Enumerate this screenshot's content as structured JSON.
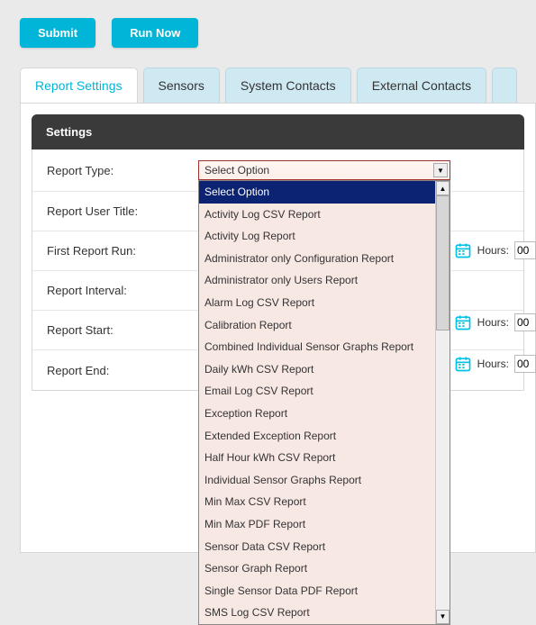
{
  "actions": {
    "submit": "Submit",
    "run_now": "Run Now"
  },
  "tabs": {
    "report_settings": "Report Settings",
    "sensors": "Sensors",
    "system_contacts": "System Contacts",
    "external_contacts": "External Contacts"
  },
  "panel": {
    "title": "Settings"
  },
  "form": {
    "report_type": {
      "label": "Report Type:",
      "selected": "Select Option"
    },
    "report_user_title": {
      "label": "Report User Title:"
    },
    "first_report_run": {
      "label": "First Report Run:",
      "hours_label": "Hours:",
      "hours_value": "00"
    },
    "report_interval": {
      "label": "Report Interval:"
    },
    "report_start": {
      "label": "Report Start:",
      "hours_label": "Hours:",
      "hours_value": "00"
    },
    "report_end": {
      "label": "Report End:",
      "hours_label": "Hours:",
      "hours_value": "00"
    }
  },
  "dropdown_options": [
    "Select Option",
    "Activity Log CSV Report",
    "Activity Log Report",
    "Administrator only Configuration Report",
    "Administrator only Users Report",
    "Alarm Log CSV Report",
    "Calibration Report",
    "Combined Individual Sensor Graphs Report",
    "Daily kWh CSV Report",
    "Email Log CSV Report",
    "Exception Report",
    "Extended Exception Report",
    "Half Hour kWh CSV Report",
    "Individual Sensor Graphs Report",
    "Min Max CSV Report",
    "Min Max PDF Report",
    "Sensor Data CSV Report",
    "Sensor Graph Report",
    "Single Sensor Data PDF Report",
    "SMS Log CSV Report"
  ]
}
